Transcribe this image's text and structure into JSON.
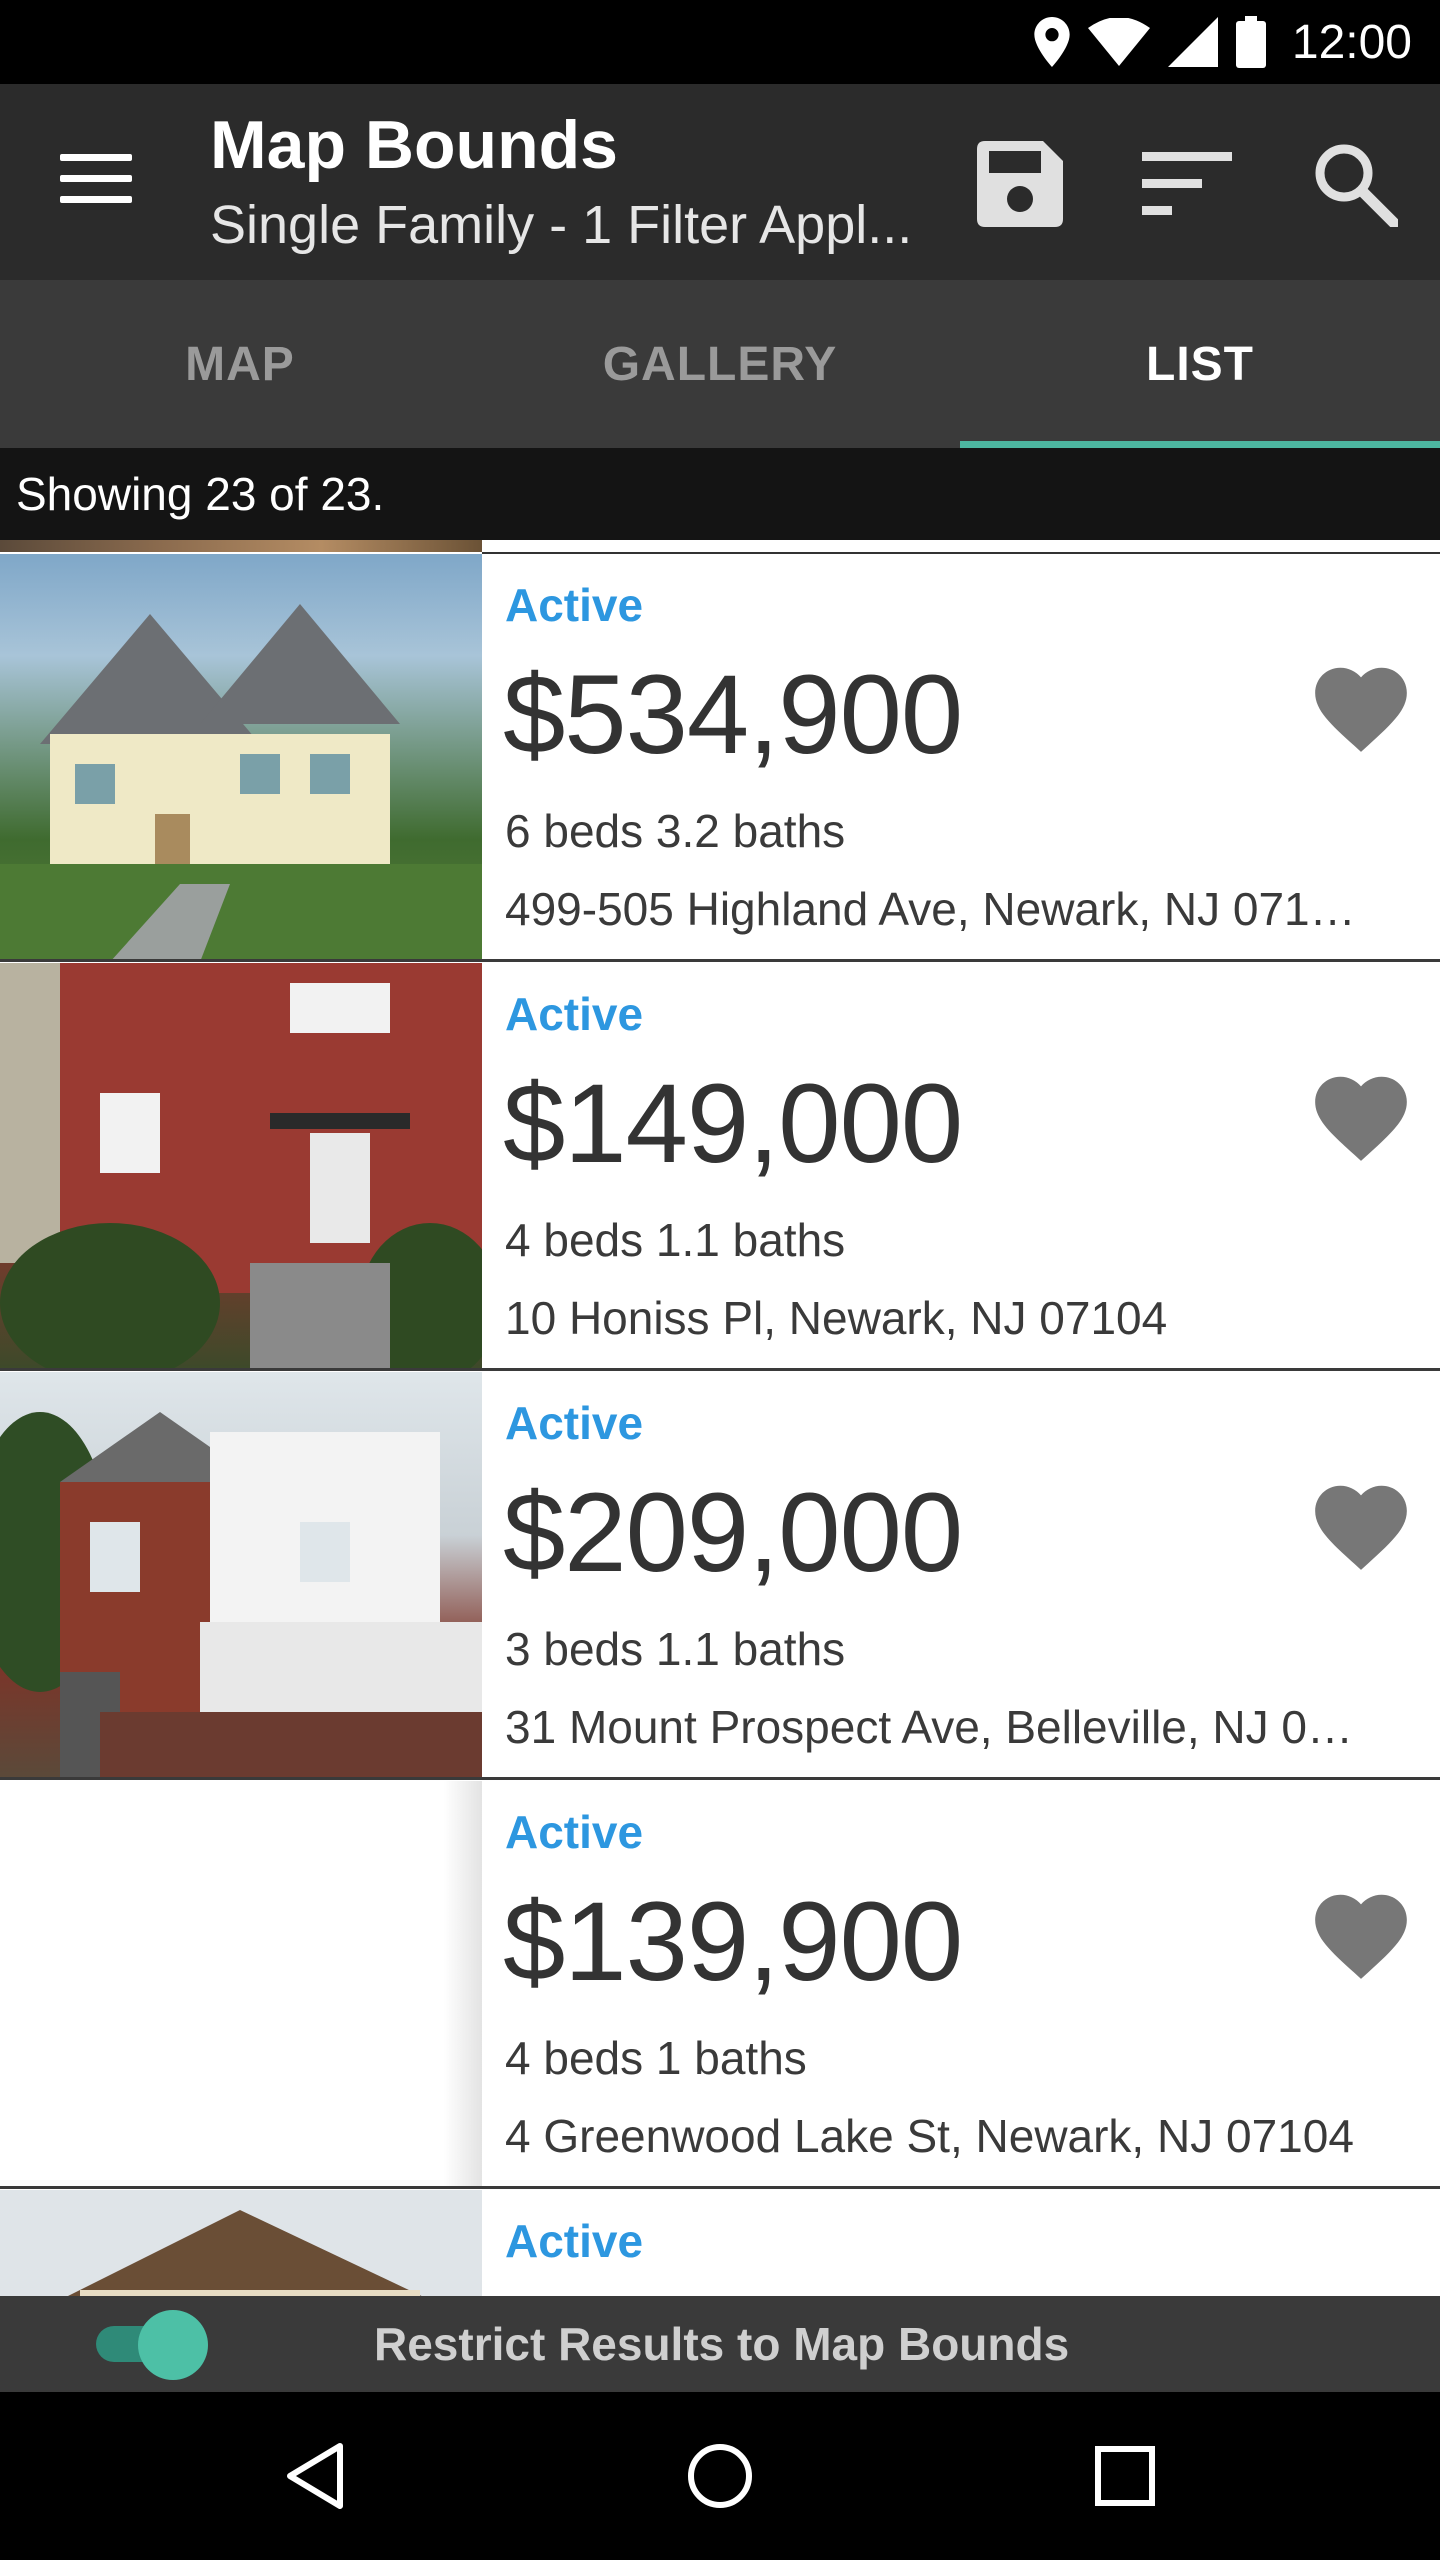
{
  "status_bar": {
    "time": "12:00",
    "icons": [
      "location-icon",
      "wifi-icon",
      "cell-signal-icon",
      "battery-icon"
    ]
  },
  "appbar": {
    "title": "Map Bounds",
    "subtitle": "Single Family - 1 Filter Appl...",
    "actions": [
      "save-icon",
      "sort-icon",
      "search-icon"
    ]
  },
  "tabs": [
    {
      "label": "MAP",
      "active": false
    },
    {
      "label": "GALLERY",
      "active": false
    },
    {
      "label": "LIST",
      "active": true
    }
  ],
  "results": {
    "showing_text": "Showing 23 of 23."
  },
  "listings": [
    {
      "status": "Active",
      "price": "$534,900",
      "beds_baths": "6 beds 3.2 baths",
      "address": "499-505 Highland Ave, Newark, NJ 071…"
    },
    {
      "status": "Active",
      "price": "$149,000",
      "beds_baths": "4 beds 1.1 baths",
      "address": "10 Honiss Pl, Newark, NJ 07104"
    },
    {
      "status": "Active",
      "price": "$209,000",
      "beds_baths": "3 beds 1.1 baths",
      "address": "31 Mount Prospect Ave, Belleville, NJ 0…"
    },
    {
      "status": "Active",
      "price": "$139,900",
      "beds_baths": "4 beds 1 baths",
      "address": "4 Greenwood Lake St, Newark, NJ 07104"
    },
    {
      "status": "Active"
    }
  ],
  "restrict_toggle": {
    "label": "Restrict Results to Map Bounds",
    "on": true
  },
  "colors": {
    "accent": "#4db6a0",
    "status_active": "#2d97e0",
    "favorite_icon": "#777777",
    "appbar": "#2b2b2b",
    "tabs": "#3a3a3a"
  },
  "nav_bar": [
    "back-icon",
    "home-icon",
    "recents-icon"
  ]
}
